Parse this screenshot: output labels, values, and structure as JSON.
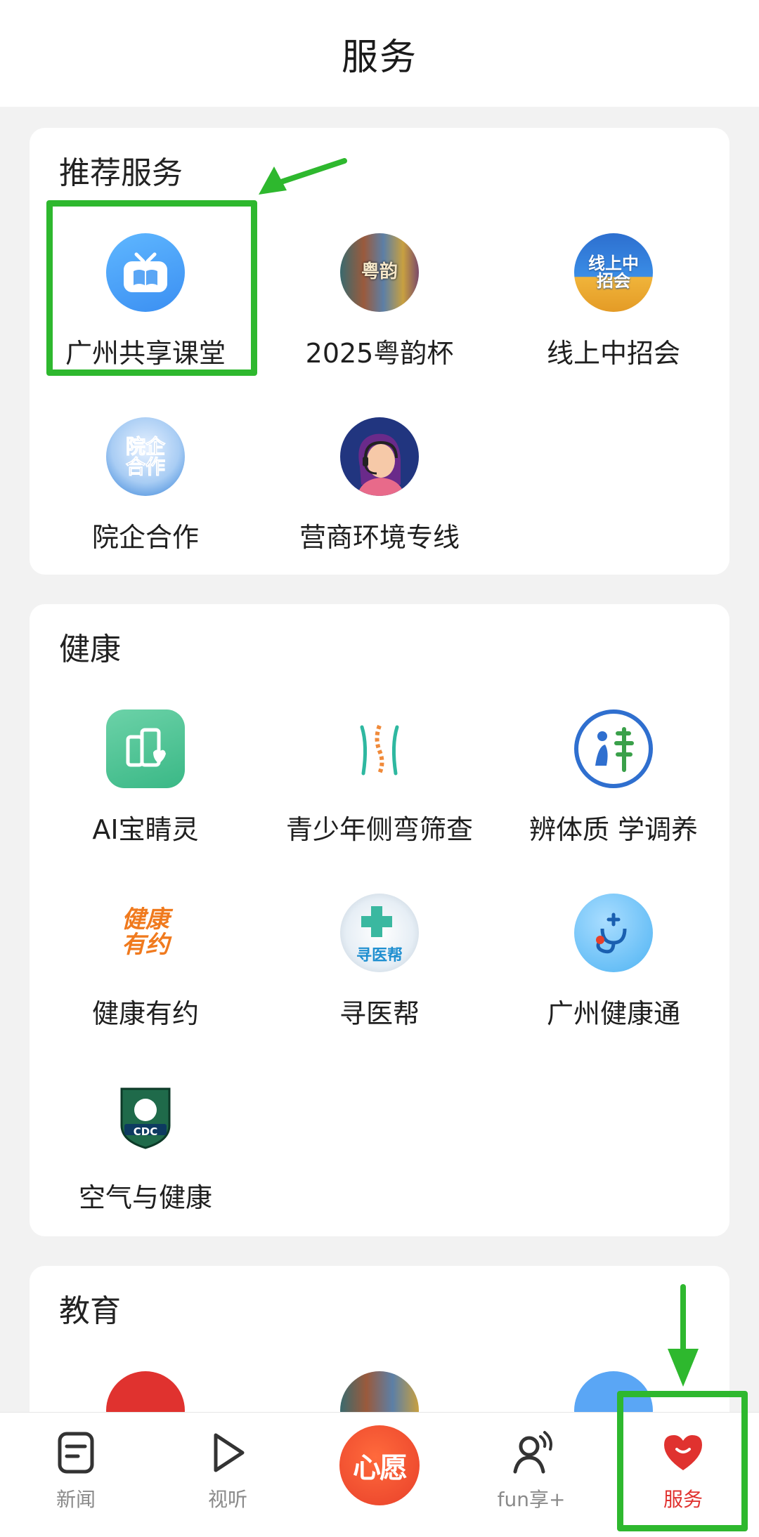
{
  "header": {
    "title": "服务"
  },
  "sections": [
    {
      "title": "推荐服务",
      "items": [
        {
          "label": "广州共享课堂",
          "icon": "tv-book-icon"
        },
        {
          "label": "2025粤韵杯",
          "icon": "yueyun-poster-icon",
          "icon_text": "粤韵"
        },
        {
          "label": "线上中招会",
          "icon": "job-fair-icon",
          "icon_text": "线上中招会"
        },
        {
          "label": "院企合作",
          "icon": "cooperation-icon",
          "icon_text": "院企合作"
        },
        {
          "label": "营商环境专线",
          "icon": "customer-service-icon"
        }
      ]
    },
    {
      "title": "健康",
      "items": [
        {
          "label": "AI宝睛灵",
          "icon": "building-heart-icon"
        },
        {
          "label": "青少年侧弯筛查",
          "icon": "spine-icon"
        },
        {
          "label": "辨体质 学调养",
          "icon": "tcm-constitution-icon"
        },
        {
          "label": "健康有约",
          "icon": "health-appointment-icon",
          "icon_text": "健康有约"
        },
        {
          "label": "寻医帮",
          "icon": "find-doctor-icon",
          "icon_text": "寻医帮"
        },
        {
          "label": "广州健康通",
          "icon": "stethoscope-icon"
        },
        {
          "label": "空气与健康",
          "icon": "cdc-badge-icon",
          "icon_text": "CDC"
        }
      ]
    },
    {
      "title": "教育",
      "items": []
    }
  ],
  "bottom_nav": {
    "items": [
      {
        "label": "新闻",
        "icon": "news-icon"
      },
      {
        "label": "视听",
        "icon": "play-icon"
      },
      {
        "label": "心愿",
        "icon": "wish-button"
      },
      {
        "label": "fun享+",
        "icon": "fun-share-icon"
      },
      {
        "label": "服务",
        "icon": "heart-service-icon",
        "active": true
      }
    ]
  },
  "colors": {
    "accent_red": "#e0322f",
    "annotation_green": "#2eb82e"
  }
}
